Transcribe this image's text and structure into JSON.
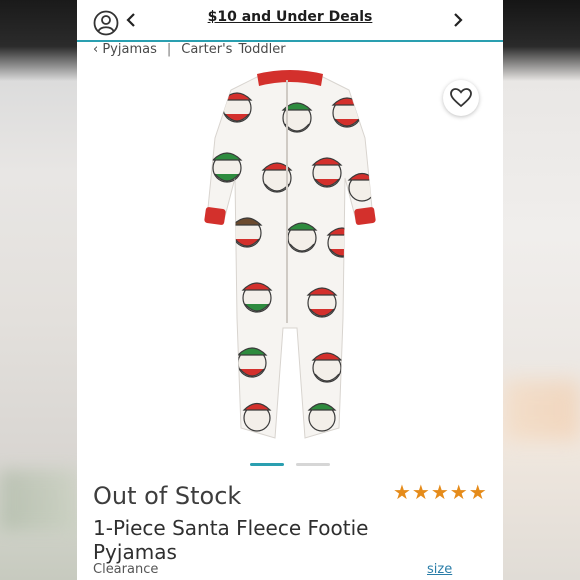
{
  "header": {
    "promo_label": "$10 and Under Deals",
    "accent_color": "#2a9fb0"
  },
  "breadcrumb": {
    "back_label": "‹ Pyjamas",
    "separator": "|",
    "brand_label": "Carter's",
    "category_label": "Toddler"
  },
  "gallery": {
    "image_count": 2,
    "active_index": 0,
    "image_subject": "white fleece footie pyjamas with Santa print"
  },
  "product": {
    "status": "Out of Stock",
    "title": "1-Piece Santa Fleece Footie Pyjamas",
    "tag": "Clearance",
    "rating_stars": "★★★★★",
    "rating_value": 5,
    "size_link": "size",
    "star_color": "#e58b1a"
  },
  "icons": {
    "user": "user-icon",
    "back": "chevron-left-icon",
    "next": "chevron-right-icon",
    "favorite": "heart-icon"
  }
}
